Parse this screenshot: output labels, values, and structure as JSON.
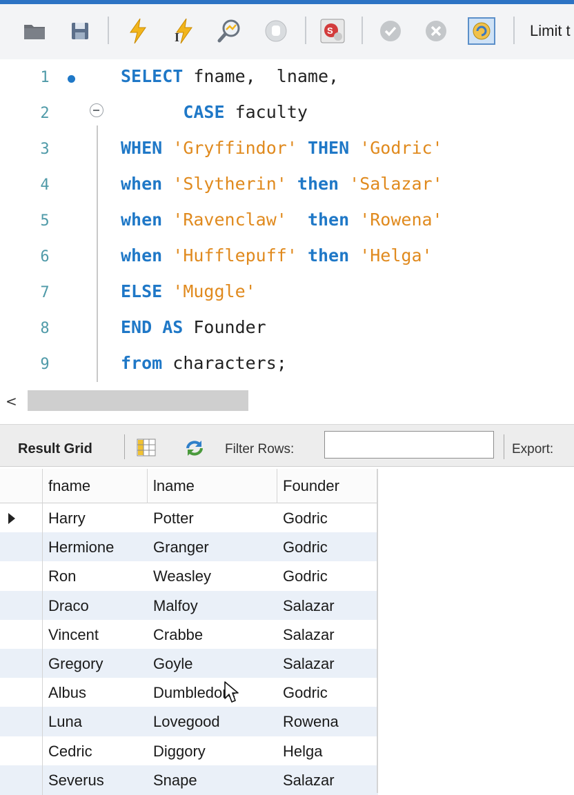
{
  "toolbar": {
    "buttons": [
      "folder-icon",
      "save-icon",
      "execute-icon",
      "execute-current-icon",
      "explain-icon",
      "stop-icon",
      "toggle-error-icon",
      "commit-icon",
      "rollback-icon",
      "autocommit-icon"
    ],
    "limit_label": "Limit t"
  },
  "editor": {
    "lines": [
      {
        "n": "1",
        "tokens": [
          {
            "t": "kw",
            "v": "SELECT "
          },
          {
            "t": "id",
            "v": "fname,  lname,"
          }
        ]
      },
      {
        "n": "2",
        "tokens": [
          {
            "t": "id",
            "v": "      "
          },
          {
            "t": "kw",
            "v": "CASE "
          },
          {
            "t": "id",
            "v": "faculty"
          }
        ]
      },
      {
        "n": "3",
        "tokens": [
          {
            "t": "kw",
            "v": "WHEN "
          },
          {
            "t": "str",
            "v": "'Gryffindor' "
          },
          {
            "t": "kw",
            "v": "THEN "
          },
          {
            "t": "str",
            "v": "'Godric'"
          }
        ]
      },
      {
        "n": "4",
        "tokens": [
          {
            "t": "kw",
            "v": "when "
          },
          {
            "t": "str",
            "v": "'Slytherin' "
          },
          {
            "t": "kw",
            "v": "then "
          },
          {
            "t": "str",
            "v": "'Salazar'"
          }
        ]
      },
      {
        "n": "5",
        "tokens": [
          {
            "t": "kw",
            "v": "when "
          },
          {
            "t": "str",
            "v": "'Ravenclaw'  "
          },
          {
            "t": "kw",
            "v": "then "
          },
          {
            "t": "str",
            "v": "'Rowena'"
          }
        ]
      },
      {
        "n": "6",
        "tokens": [
          {
            "t": "kw",
            "v": "when "
          },
          {
            "t": "str",
            "v": "'Hufflepuff' "
          },
          {
            "t": "kw",
            "v": "then "
          },
          {
            "t": "str",
            "v": "'Helga'"
          }
        ]
      },
      {
        "n": "7",
        "tokens": [
          {
            "t": "kw",
            "v": "ELSE "
          },
          {
            "t": "str",
            "v": "'Muggle'"
          }
        ]
      },
      {
        "n": "8",
        "tokens": [
          {
            "t": "kw",
            "v": "END AS "
          },
          {
            "t": "id",
            "v": "Founder"
          }
        ]
      },
      {
        "n": "9",
        "tokens": [
          {
            "t": "kw",
            "v": "from "
          },
          {
            "t": "id",
            "v": "characters;"
          }
        ]
      }
    ]
  },
  "scrollbar": {
    "left_arrow": "<"
  },
  "result_bar": {
    "title": "Result Grid",
    "filter_label": "Filter Rows:",
    "filter_value": "",
    "export_label": "Export:"
  },
  "grid": {
    "columns": [
      "fname",
      "lname",
      "Founder"
    ],
    "rows": [
      [
        "Harry",
        "Potter",
        "Godric"
      ],
      [
        "Hermione",
        "Granger",
        "Godric"
      ],
      [
        "Ron",
        "Weasley",
        "Godric"
      ],
      [
        "Draco",
        "Malfoy",
        "Salazar"
      ],
      [
        "Vincent",
        "Crabbe",
        "Salazar"
      ],
      [
        "Gregory",
        "Goyle",
        "Salazar"
      ],
      [
        "Albus",
        "Dumbledore",
        "Godric"
      ],
      [
        "Luna",
        "Lovegood",
        "Rowena"
      ],
      [
        "Cedric",
        "Diggory",
        "Helga"
      ],
      [
        "Severus",
        "Snape",
        "Salazar"
      ]
    ],
    "current_row": 0
  },
  "colors": {
    "keyword": "#1f78c7",
    "string": "#e08a1e",
    "line_number": "#4f9aa8",
    "alt_row": "#eaf0f8",
    "accent": "#2c73c4"
  }
}
